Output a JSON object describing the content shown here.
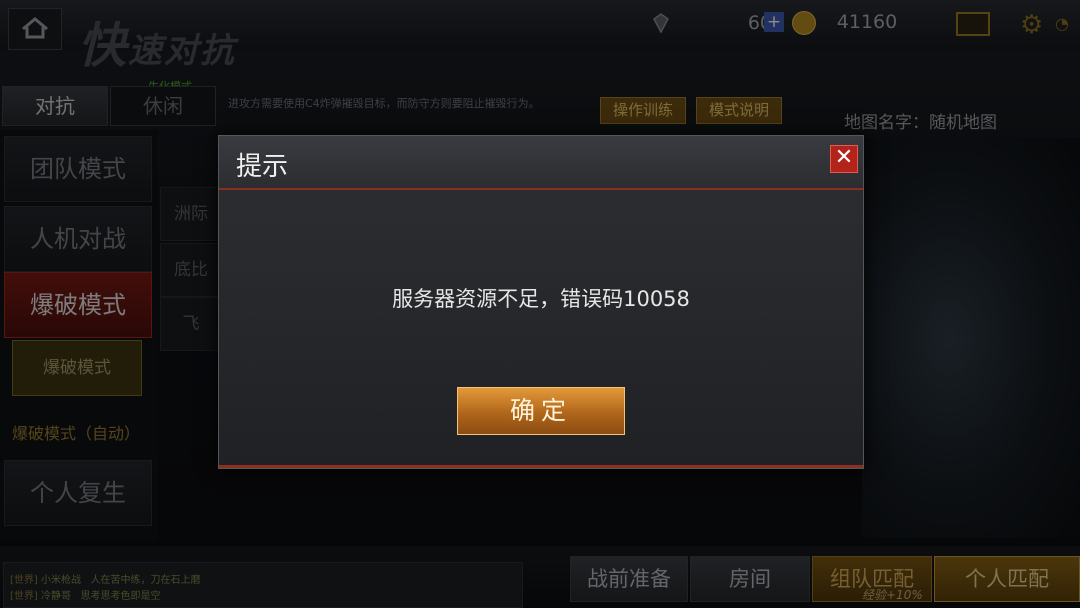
{
  "header": {
    "title_big": "快",
    "title_rest": "速对抗",
    "mode_badge": "生化模式",
    "description": "进攻方需要使用C4炸弹摧毁目标，而防守方则要阻止摧毁行为。",
    "gems": "60",
    "coins": "41160"
  },
  "tabs": [
    {
      "label": "对抗"
    },
    {
      "label": "休闲"
    }
  ],
  "actions": {
    "training": "操作训练",
    "rules": "模式说明",
    "map_name": "地图名字：随机地图"
  },
  "sidebar": {
    "items": [
      {
        "label": "团队模式"
      },
      {
        "label": "人机对战"
      },
      {
        "label": "爆破模式"
      },
      {
        "label": "个人复生"
      }
    ],
    "sub_selected": "爆破模式",
    "sub_auto": "爆破模式（自动）"
  },
  "map_list": [
    "洲际",
    "底比",
    "飞"
  ],
  "chat": [
    {
      "channel": "[世界]",
      "user": "小米枪战",
      "text": "人在苦中练，刀在石上磨"
    },
    {
      "channel": "[世界]",
      "user": "冷静哥",
      "text": "思考思考色即是空"
    }
  ],
  "bottom": {
    "prep": "战前准备",
    "room": "房间",
    "team_match": "组队匹配",
    "solo_match": "个人匹配",
    "exp_bonus": "经验+10%"
  },
  "dialog": {
    "title": "提示",
    "message": "服务器资源不足，错误码10058",
    "confirm": "确定"
  },
  "colors": {
    "accent_red": "#b3231a",
    "button_orange": "#e39a39",
    "gold": "#d9b058"
  }
}
